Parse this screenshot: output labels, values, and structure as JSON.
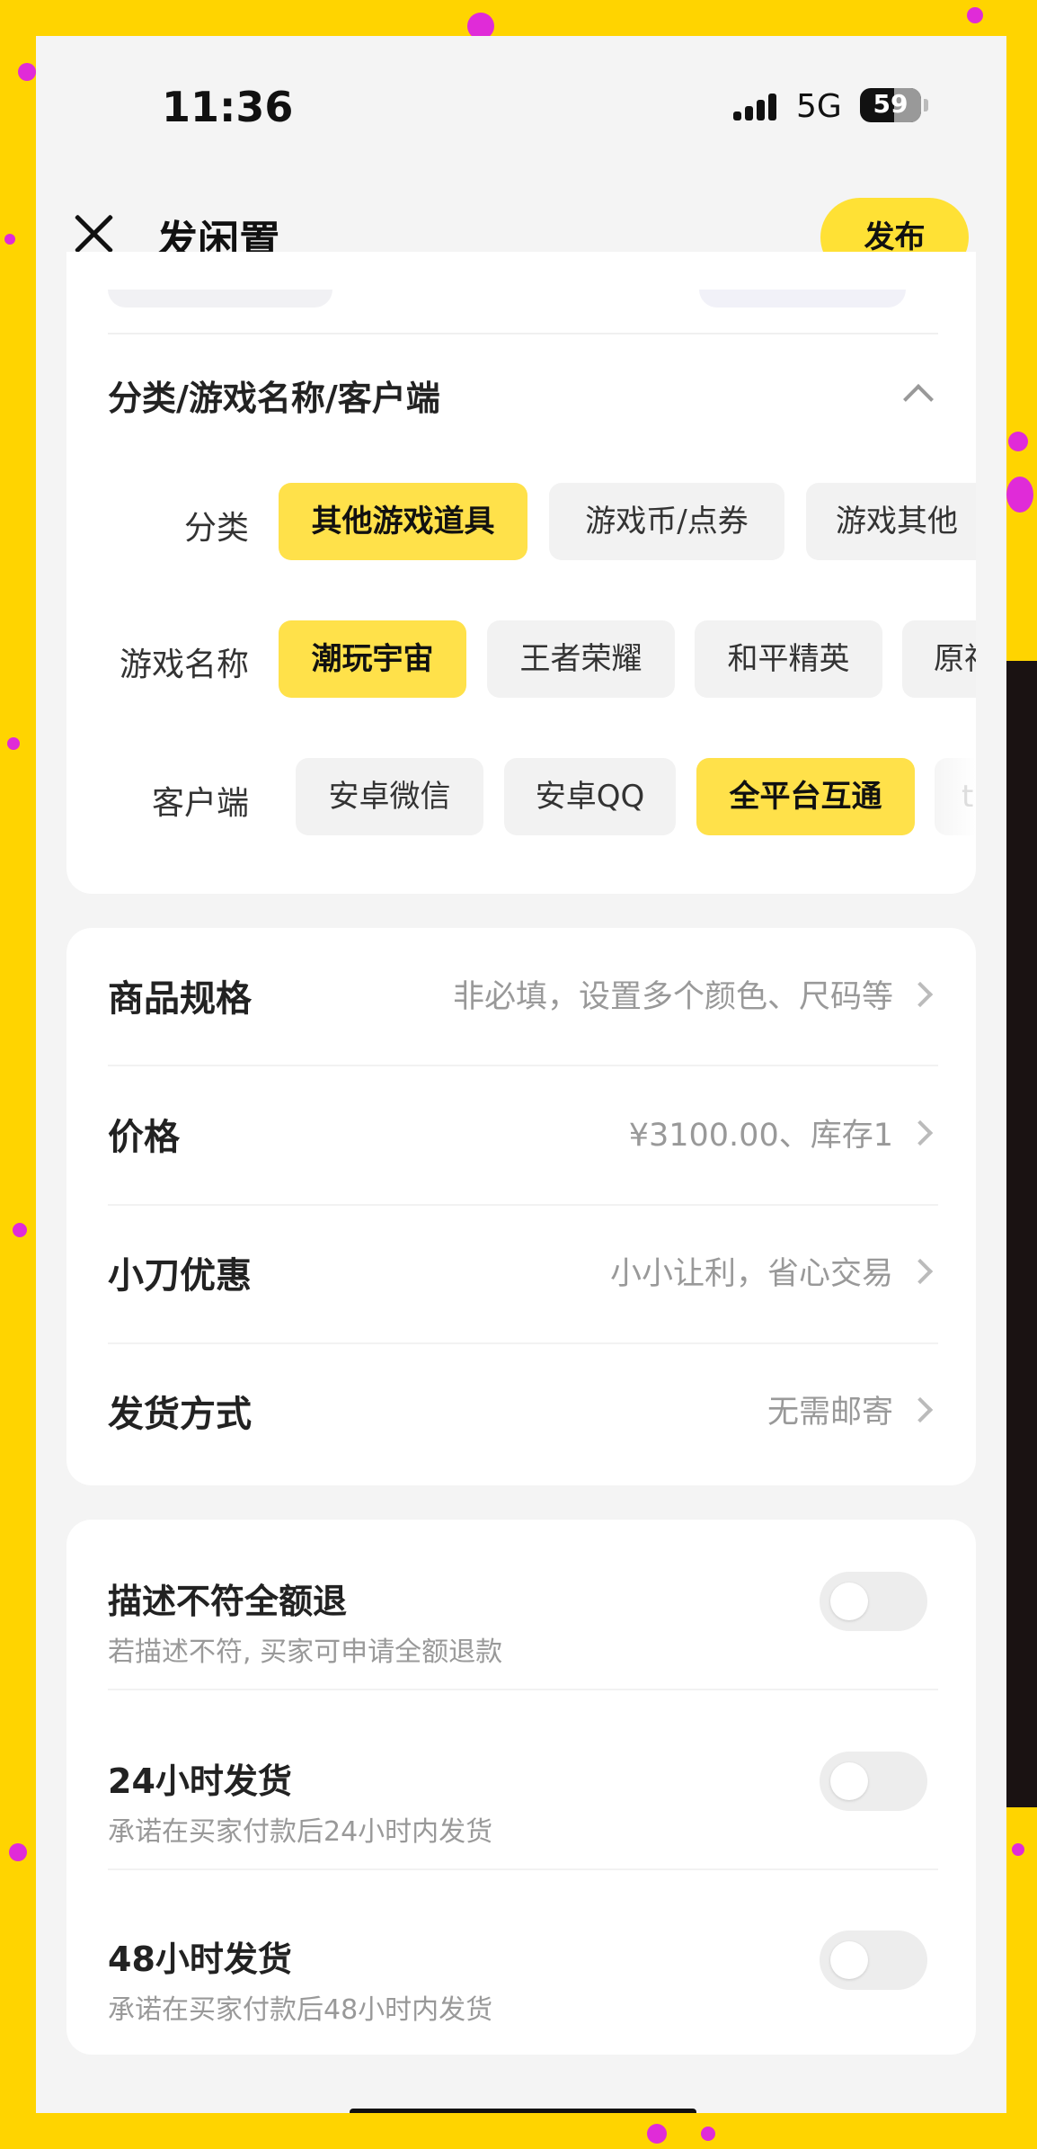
{
  "status_bar": {
    "time": "11:36",
    "network": "5G",
    "battery": "59"
  },
  "nav": {
    "title": "发闲置",
    "publish_label": "发布"
  },
  "category_section": {
    "title": "分类/游戏名称/客户端",
    "rows": [
      {
        "label": "分类",
        "options": [
          "其他游戏道具",
          "游戏币/点券",
          "游戏其他"
        ],
        "selected": "其他游戏道具"
      },
      {
        "label": "游戏名称",
        "options": [
          "潮玩宇宙",
          "王者荣耀",
          "和平精英",
          "原神"
        ],
        "selected": "潮玩宇宙"
      },
      {
        "label": "客户端",
        "options": [
          "安卓微信",
          "安卓QQ",
          "全平台互通",
          "t"
        ],
        "selected": "全平台互通"
      }
    ]
  },
  "specs": [
    {
      "label": "商品规格",
      "value": "非必填，设置多个颜色、尺码等"
    },
    {
      "label": "价格",
      "value": "¥3100.00、库存1"
    },
    {
      "label": "小刀优惠",
      "value": "小小让利，省心交易"
    },
    {
      "label": "发货方式",
      "value": "无需邮寄"
    }
  ],
  "toggles": [
    {
      "title": "描述不符全额退",
      "subtitle": "若描述不符, 买家可申请全额退款",
      "on": false
    },
    {
      "title": "24小时发货",
      "subtitle": "承诺在买家付款后24小时内发货",
      "on": false
    },
    {
      "title": "48小时发货",
      "subtitle": "承诺在买家付款后48小时内发货",
      "on": false
    }
  ],
  "colors": {
    "accent": "#FFE14A",
    "background": "#FFD400",
    "dots": "#E02BD8"
  }
}
